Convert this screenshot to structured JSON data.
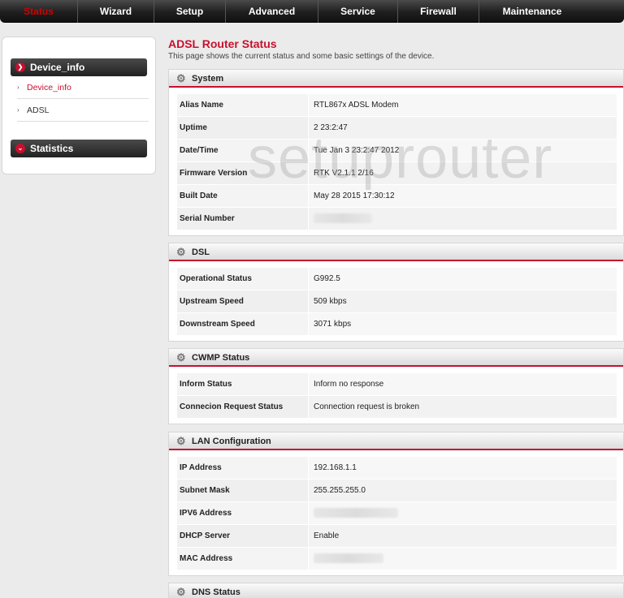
{
  "nav": {
    "tabs": [
      {
        "label": "Status",
        "active": true
      },
      {
        "label": "Wizard",
        "active": false
      },
      {
        "label": "Setup",
        "active": false
      },
      {
        "label": "Advanced",
        "active": false
      },
      {
        "label": "Service",
        "active": false
      },
      {
        "label": "Firewall",
        "active": false
      },
      {
        "label": "Maintenance",
        "active": false
      }
    ]
  },
  "watermark": "setuprouter",
  "sidebar": {
    "groups": [
      {
        "label": "Device_info",
        "expanded": true,
        "items": [
          {
            "label": "Device_info",
            "active": true
          },
          {
            "label": "ADSL",
            "active": false
          }
        ]
      },
      {
        "label": "Statistics",
        "expanded": false,
        "items": []
      }
    ]
  },
  "page": {
    "title": "ADSL Router Status",
    "description": "This page shows the current status and some basic settings of the device."
  },
  "sections": {
    "system": {
      "title": "System",
      "rows": [
        {
          "key": "Alias Name",
          "value": "RTL867x ADSL Modem"
        },
        {
          "key": "Uptime",
          "value": "2 23:2:47"
        },
        {
          "key": "Date/Time",
          "value": "Tue Jan 3 23:2:47 2012"
        },
        {
          "key": "Firmware Version",
          "value": "RTK V2.1.1 2/16"
        },
        {
          "key": "Built Date",
          "value": "May 28 2015 17:30:12"
        },
        {
          "key": "Serial Number",
          "value": ""
        }
      ]
    },
    "dsl": {
      "title": "DSL",
      "rows": [
        {
          "key": "Operational Status",
          "value": "G992.5"
        },
        {
          "key": "Upstream Speed",
          "value": "509 kbps"
        },
        {
          "key": "Downstream Speed",
          "value": "3071 kbps"
        }
      ]
    },
    "cwmp": {
      "title": "CWMP Status",
      "rows": [
        {
          "key": "Inform Status",
          "value": "Inform no response"
        },
        {
          "key": "Connecion Request Status",
          "value": "Connection request is broken"
        }
      ]
    },
    "lan": {
      "title": "LAN Configuration",
      "rows": [
        {
          "key": "IP Address",
          "value": "192.168.1.1"
        },
        {
          "key": "Subnet Mask",
          "value": "255.255.255.0"
        },
        {
          "key": "IPV6 Address",
          "value": ""
        },
        {
          "key": "DHCP Server",
          "value": "Enable"
        },
        {
          "key": "MAC Address",
          "value": ""
        }
      ]
    },
    "dns": {
      "title": "DNS Status",
      "rows": []
    }
  },
  "colors": {
    "accent": "#c8102e",
    "nav_bg": "#1f1f1f"
  }
}
